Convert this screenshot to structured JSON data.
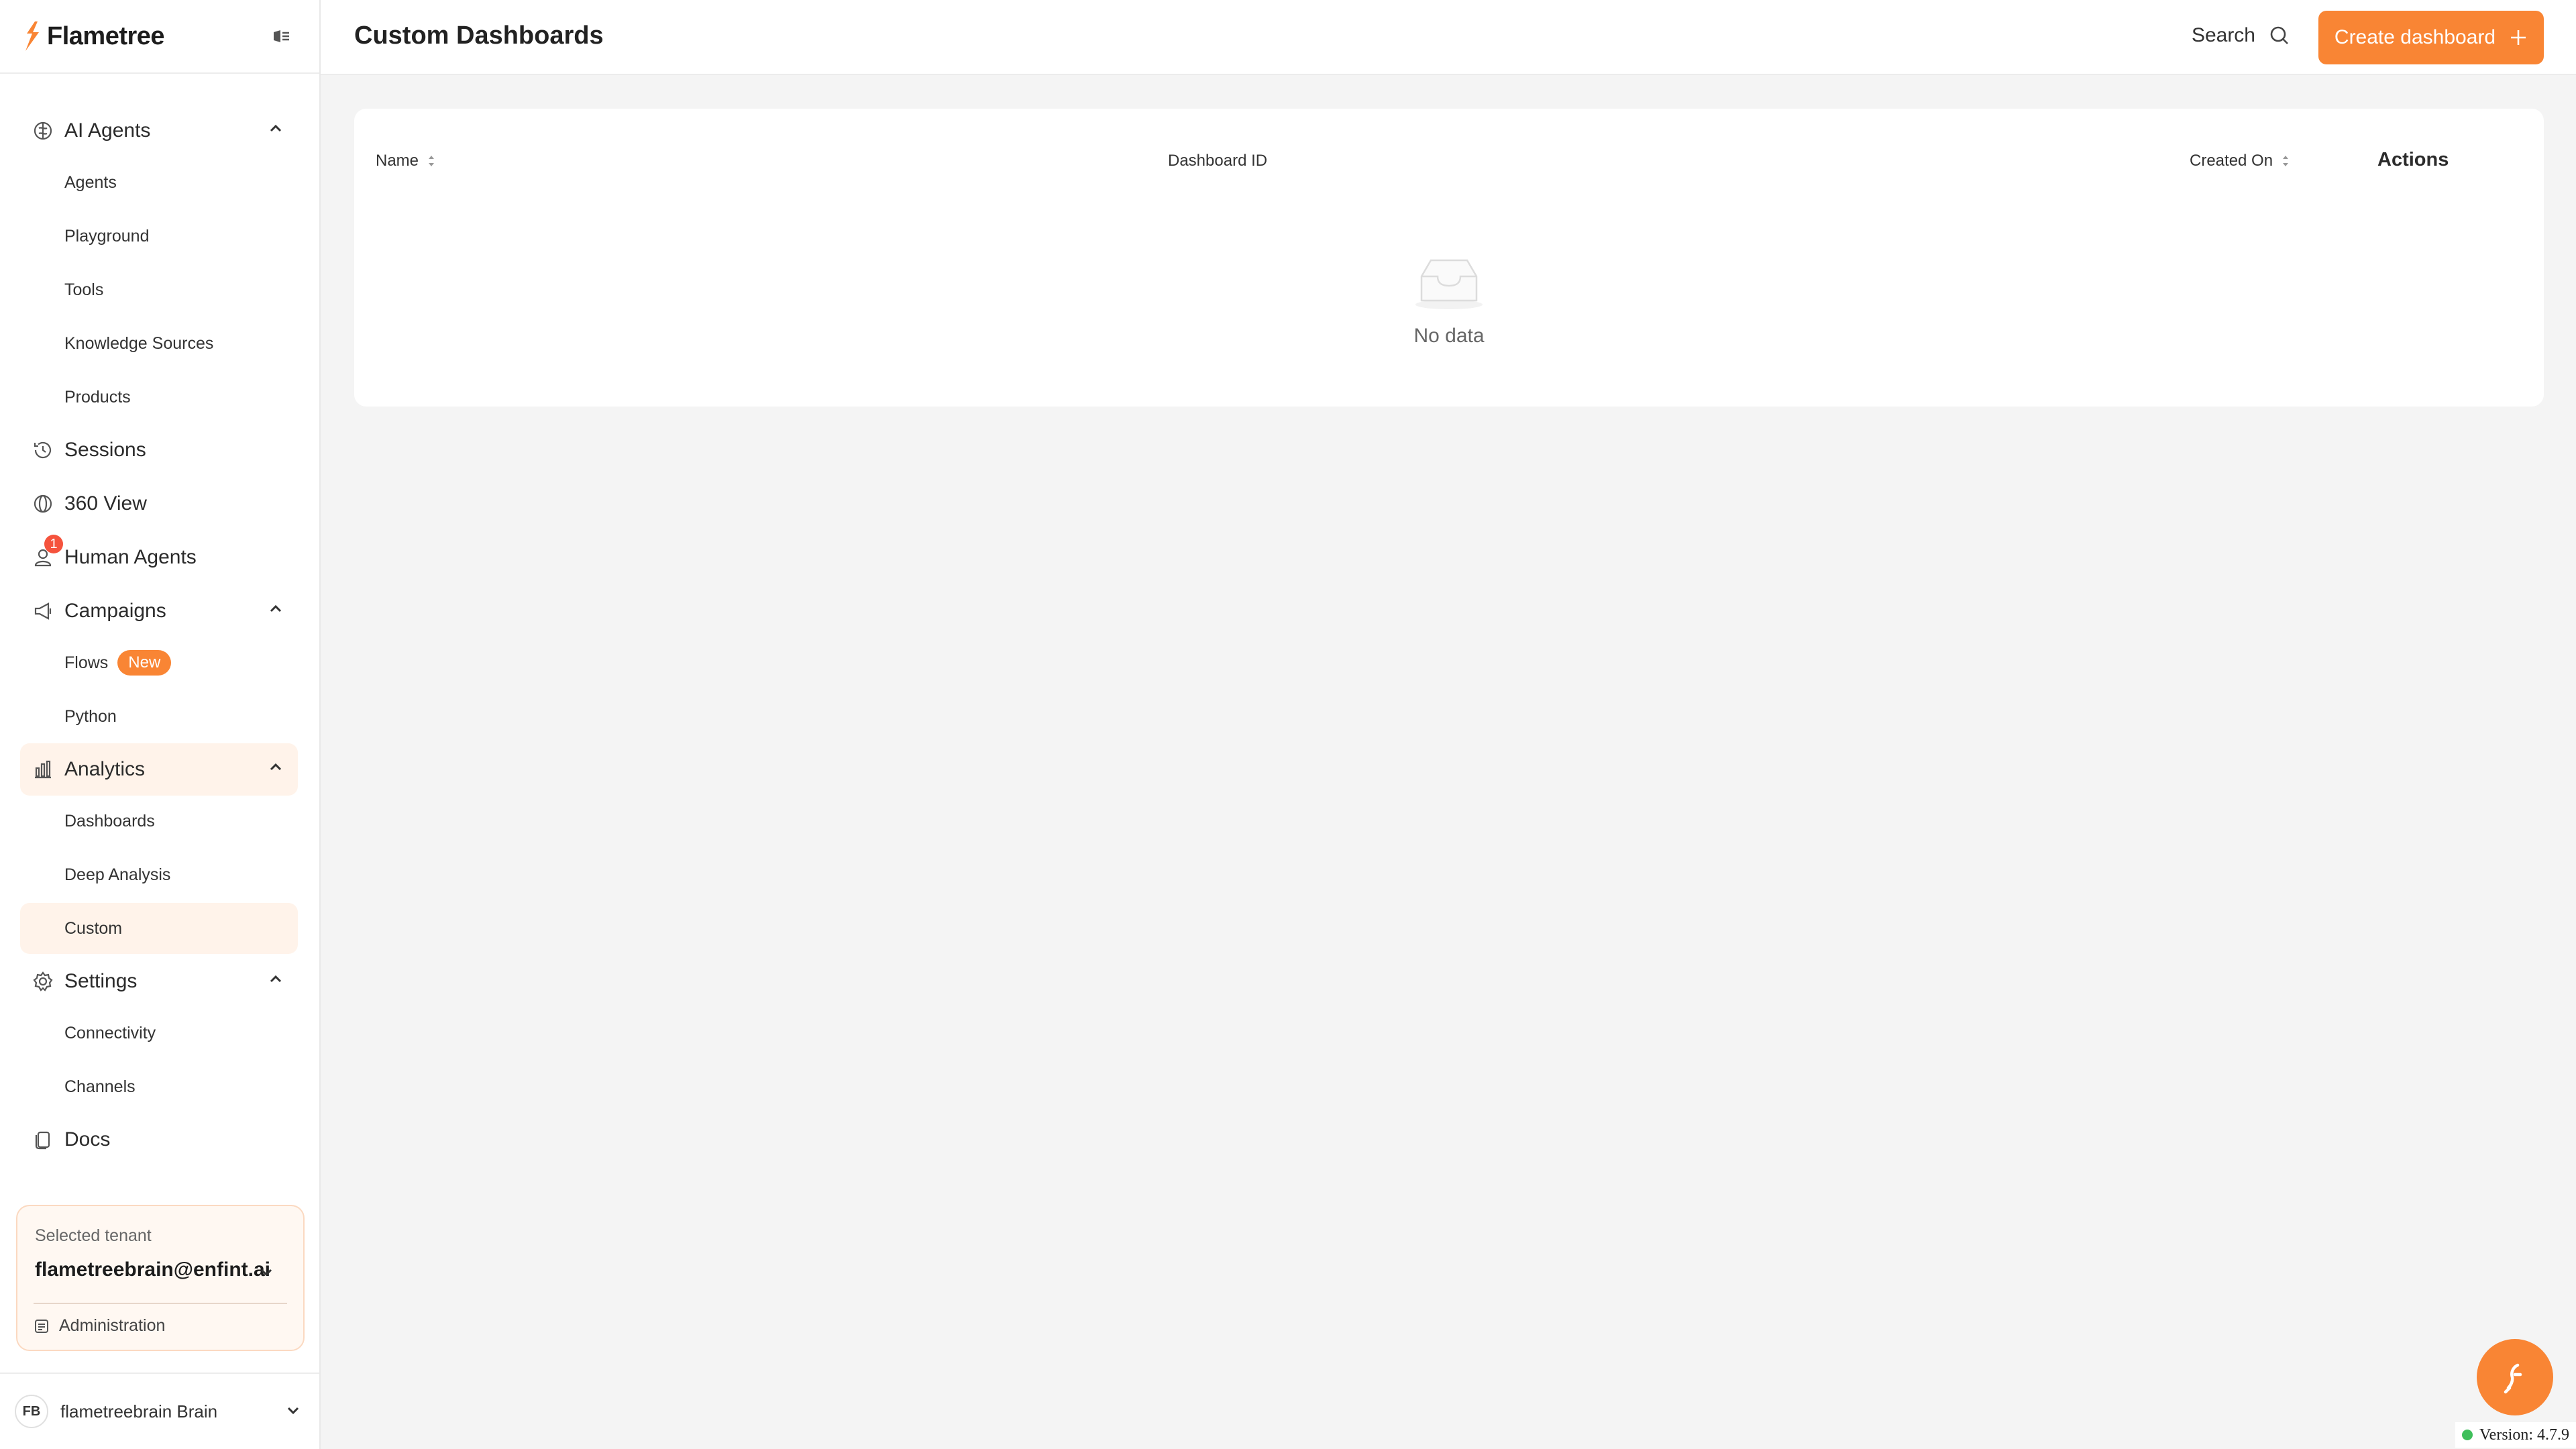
{
  "brand": {
    "name": "Flametree"
  },
  "sidebar": {
    "ai_agents": {
      "label": "AI Agents",
      "items": [
        "Agents",
        "Playground",
        "Tools",
        "Knowledge Sources",
        "Products"
      ]
    },
    "sessions": {
      "label": "Sessions"
    },
    "view360": {
      "label": "360 View"
    },
    "human_agents": {
      "label": "Human Agents",
      "badge": "1"
    },
    "campaigns": {
      "label": "Campaigns",
      "items": {
        "flows": "Flows",
        "flows_badge": "New",
        "python": "Python"
      }
    },
    "analytics": {
      "label": "Analytics",
      "items": [
        "Dashboards",
        "Deep Analysis",
        "Custom"
      ]
    },
    "settings": {
      "label": "Settings",
      "items": [
        "Connectivity",
        "Channels"
      ]
    },
    "docs": {
      "label": "Docs"
    }
  },
  "tenant": {
    "label": "Selected tenant",
    "value": "flametreebrain@enfint.ai",
    "admin": "Administration"
  },
  "user": {
    "initials": "FB",
    "name": "flametreebrain Brain"
  },
  "header": {
    "title": "Custom Dashboards",
    "search": "Search",
    "create": "Create dashboard"
  },
  "table": {
    "columns": {
      "name": "Name",
      "id": "Dashboard ID",
      "created": "Created On",
      "actions": "Actions"
    },
    "empty": "No data"
  },
  "version": "Version: 4.7.9",
  "colors": {
    "accent": "#f98534",
    "active_bg": "#fff3ea",
    "badge_red": "#f5533d"
  }
}
